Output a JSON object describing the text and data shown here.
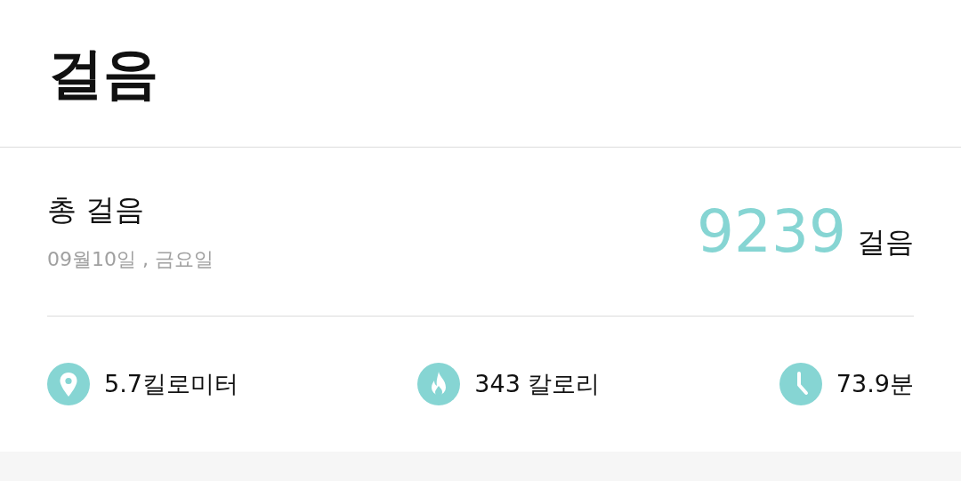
{
  "header": {
    "title": "걸음"
  },
  "summary": {
    "label": "총 걸음",
    "date": "09월10일 , 금요일",
    "steps": "9239",
    "unit": "걸음"
  },
  "stats": [
    {
      "kind": "distance",
      "text": "5.7킬로미터"
    },
    {
      "kind": "calories",
      "text": "343 칼로리"
    },
    {
      "kind": "time",
      "text": "73.9분"
    }
  ]
}
